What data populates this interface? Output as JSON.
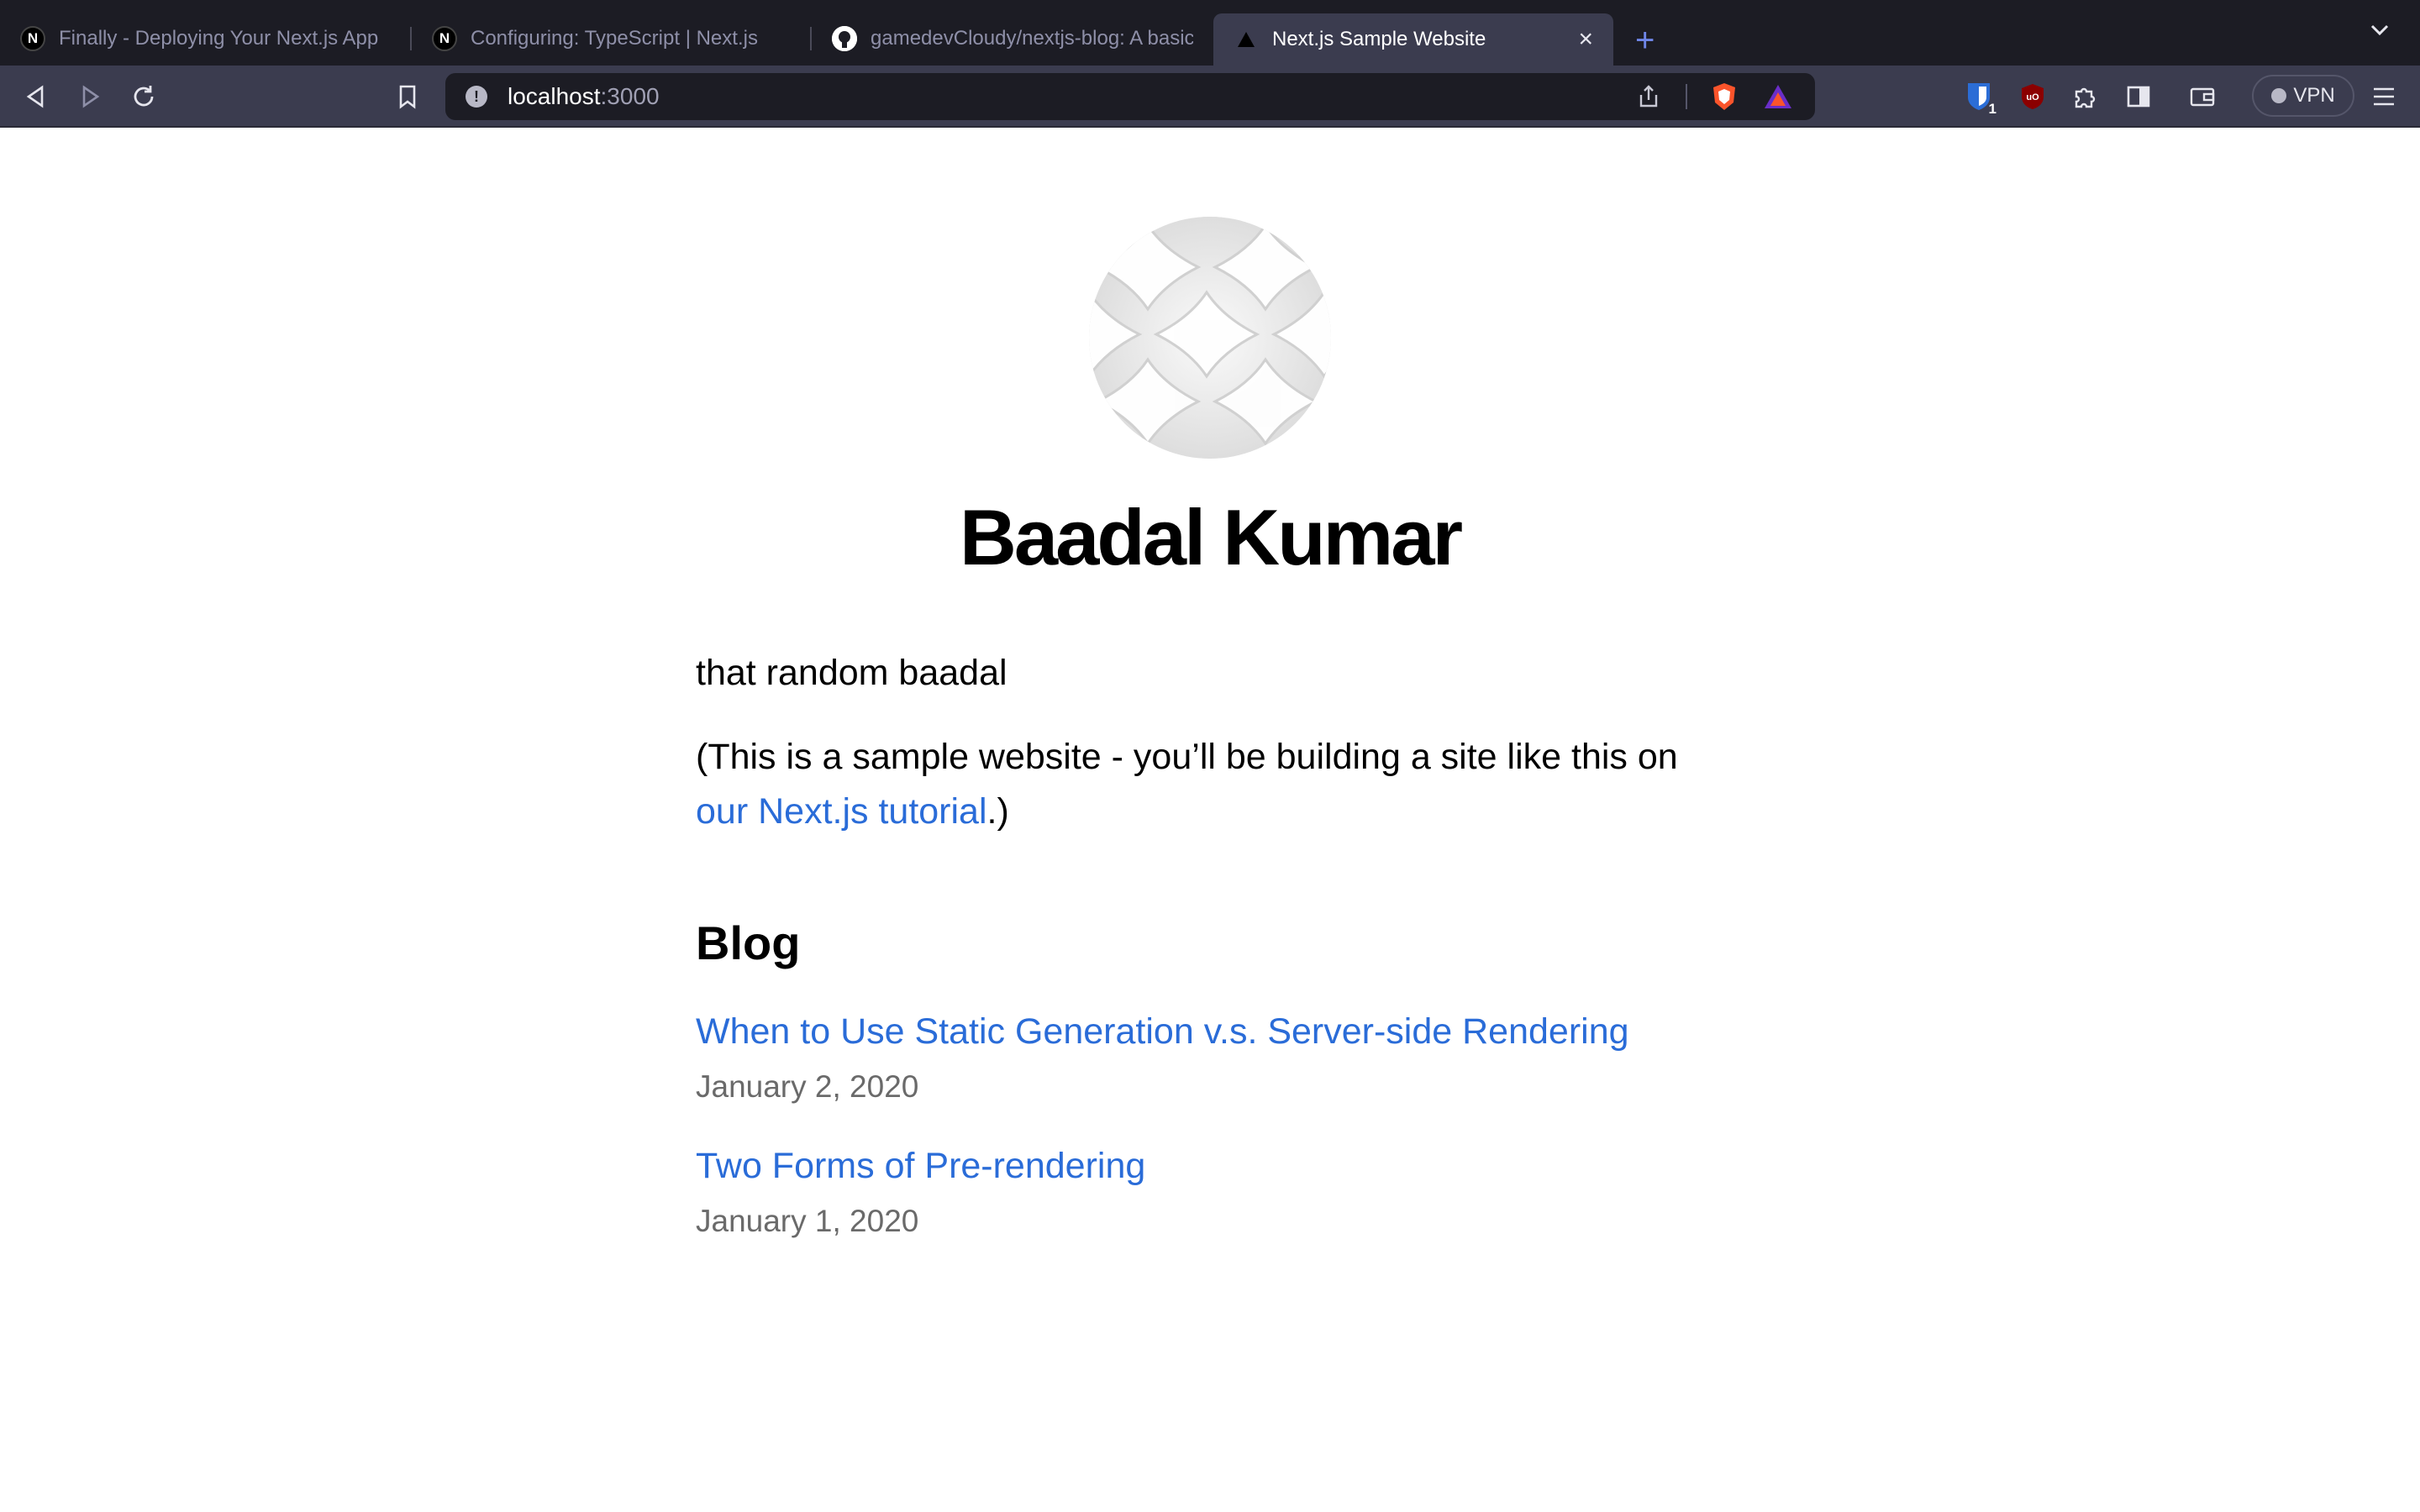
{
  "browser": {
    "tabs": [
      {
        "title": "Finally - Deploying Your Next.js App",
        "favicon": "nextjs-icon",
        "active": false
      },
      {
        "title": "Configuring: TypeScript | Next.js",
        "favicon": "nextjs-icon",
        "active": false
      },
      {
        "title": "gamedevCloudy/nextjs-blog: A basic",
        "favicon": "github-icon",
        "active": false
      },
      {
        "title": "Next.js Sample Website",
        "favicon": "vercel-triangle-icon",
        "active": true
      }
    ],
    "url": {
      "host": "localhost",
      "port": ":3000"
    },
    "extension_badge": "1",
    "vpn_label": "VPN"
  },
  "page": {
    "name": "Baadal Kumar",
    "bio": "that random baadal",
    "note_prefix": "(This is a sample website - you’ll be building a site like this on ",
    "note_link": "our Next.js tutorial",
    "note_suffix": ".)",
    "blog_heading": "Blog",
    "posts": [
      {
        "title": "When to Use Static Generation v.s. Server-side Rendering",
        "date": "January 2, 2020"
      },
      {
        "title": "Two Forms of Pre-rendering",
        "date": "January 1, 2020"
      }
    ]
  },
  "colors": {
    "chrome_dark": "#1c1c24",
    "chrome_toolbar": "#3b3c4f",
    "link_blue": "#2a6cd8",
    "brave_orange": "#fb542b"
  }
}
